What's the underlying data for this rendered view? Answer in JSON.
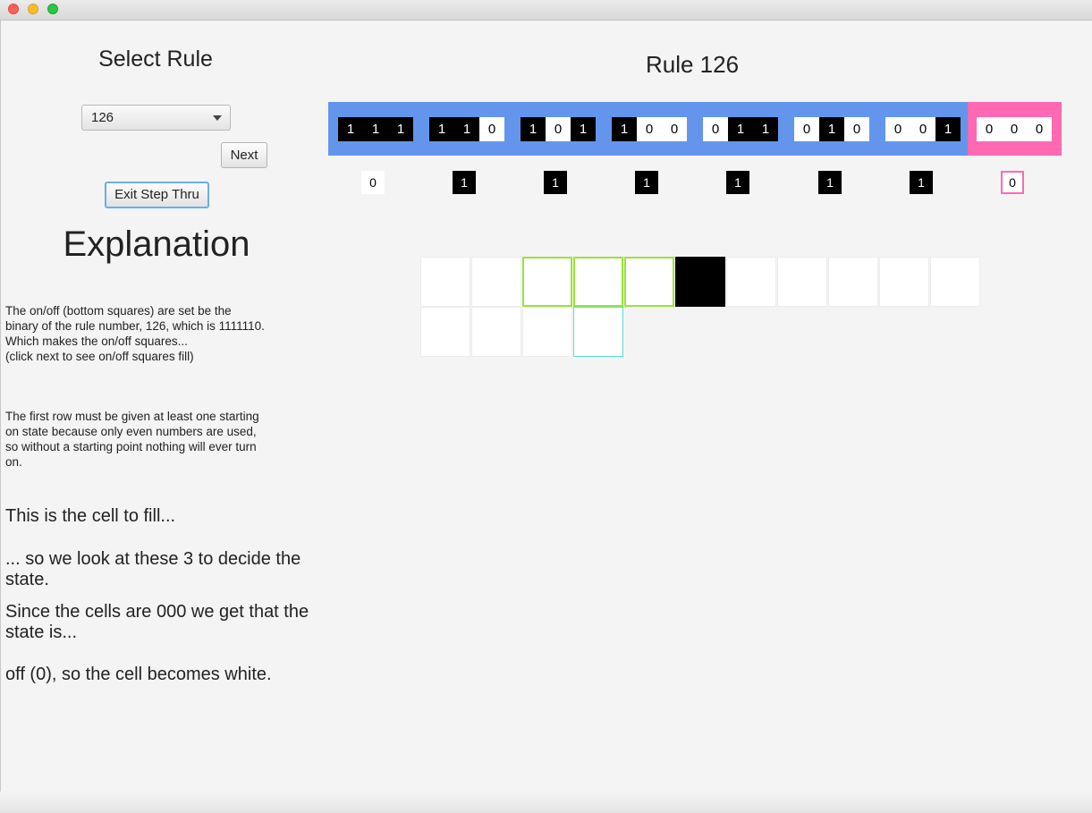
{
  "window": {
    "close": "close",
    "minimize": "minimize",
    "maximize": "maximize"
  },
  "left_panel": {
    "select_title": "Select Rule",
    "rule_dropdown_value": "126",
    "next_label": "Next",
    "exit_label": "Exit Step Thru",
    "explanation_title": "Explanation",
    "para1": "The on/off (bottom squares) are set be the\nbinary of the rule number, 126, which is 1111110.\nWhich makes the on/off squares...\n (click next to see on/off squares fill)",
    "para2": "The first row must be given at least one starting\non state because only even numbers are used,\nso without a starting point nothing will ever turn\non.",
    "step1": "This is the cell to fill...",
    "step2": "... so we look at these 3 to decide the state.",
    "step3": "Since the cells are 000 we get that the state is...",
    "step4": "off (0), so the cell becomes white."
  },
  "rule_title": "Rule 126",
  "patterns": [
    {
      "bits": [
        "1",
        "1",
        "1"
      ],
      "result": "0"
    },
    {
      "bits": [
        "1",
        "1",
        "0"
      ],
      "result": "1"
    },
    {
      "bits": [
        "1",
        "0",
        "1"
      ],
      "result": "1"
    },
    {
      "bits": [
        "1",
        "0",
        "0"
      ],
      "result": "1"
    },
    {
      "bits": [
        "0",
        "1",
        "1"
      ],
      "result": "1"
    },
    {
      "bits": [
        "0",
        "1",
        "0"
      ],
      "result": "1"
    },
    {
      "bits": [
        "0",
        "0",
        "1"
      ],
      "result": "1"
    },
    {
      "bits": [
        "0",
        "0",
        "0"
      ],
      "result": "0"
    }
  ],
  "highlighted_pattern": "000",
  "colors": {
    "pattern_bar": "#6495ed",
    "active_pattern": "#ff69b4",
    "neighbor_highlight": "#9ae43a",
    "current_cell": "#55dede"
  },
  "grid": {
    "row1": [
      0,
      0,
      0,
      0,
      0,
      1,
      0,
      0,
      0,
      0,
      0
    ],
    "row2": [
      0,
      0,
      0,
      0
    ]
  }
}
